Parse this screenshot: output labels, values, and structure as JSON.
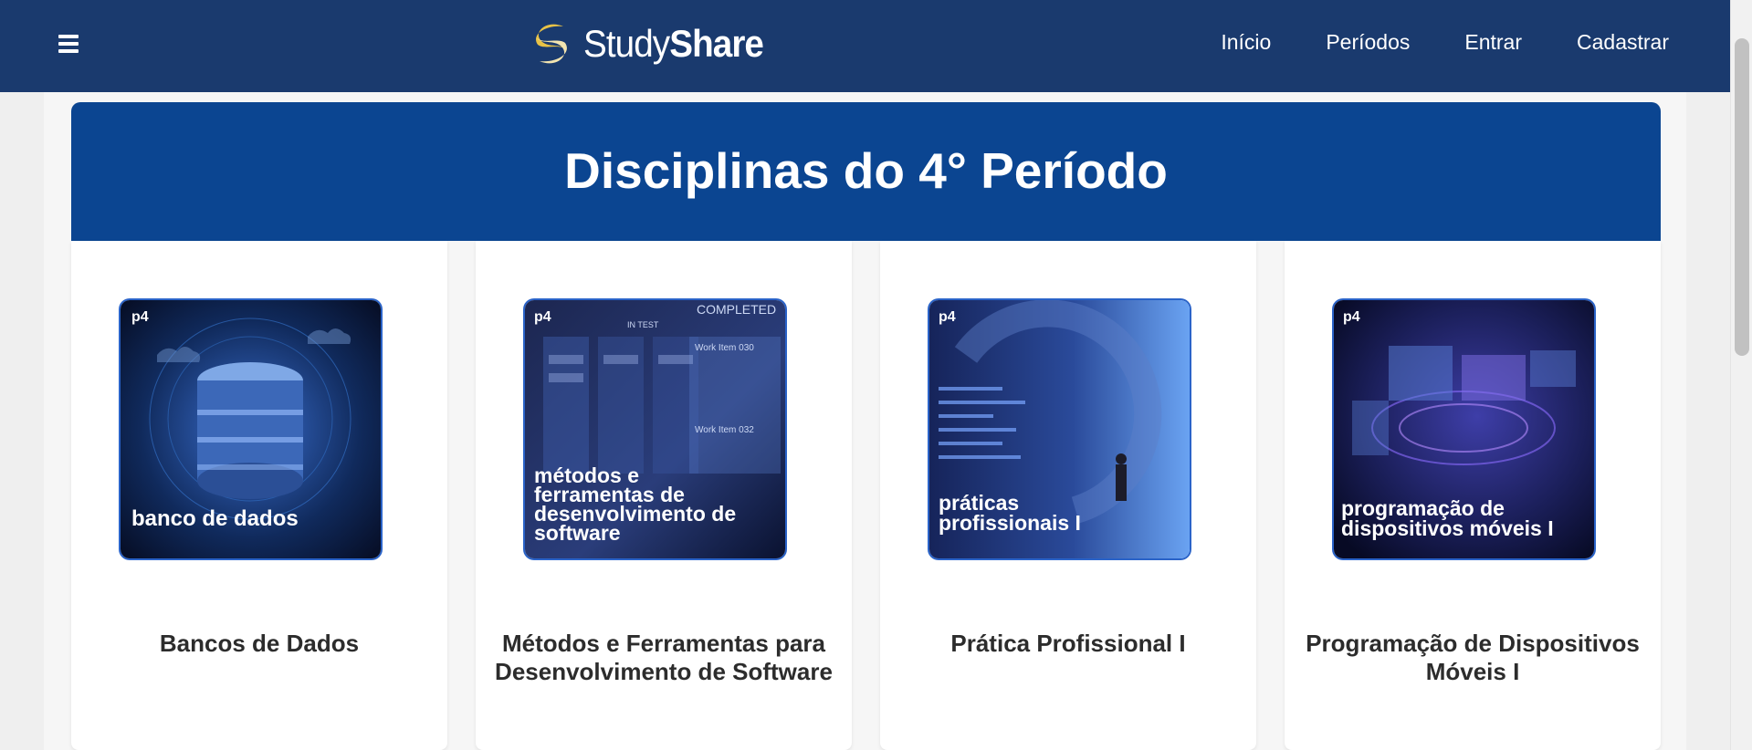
{
  "nav": {
    "brand_study": "Study",
    "brand_share": "Share",
    "links": [
      "Início",
      "Períodos",
      "Entrar",
      "Cadastrar"
    ]
  },
  "hero": {
    "title": "Disciplinas do 4° Período"
  },
  "cards": [
    {
      "badge": "p4",
      "image_caption": "banco de dados",
      "title": "Bancos de Dados"
    },
    {
      "badge": "p4",
      "image_caption": "métodos e ferramentas de desenvolvimento de software",
      "title": "Métodos e Ferramentas para Desenvolvimento de Software",
      "image_labels": [
        "IN TEST",
        "COMPLETED",
        "Work Item 030",
        "Work Item 032"
      ]
    },
    {
      "badge": "p4",
      "image_caption": "práticas profissionais I",
      "title": "Prática Profissional I"
    },
    {
      "badge": "p4",
      "image_caption": "programação de dispositivos móveis I",
      "title": "Programação de Dispositivos Móveis I"
    }
  ],
  "colors": {
    "navbar": "#1a3a6e",
    "hero": "#0b4591",
    "brand_accent": "#e8c247"
  }
}
